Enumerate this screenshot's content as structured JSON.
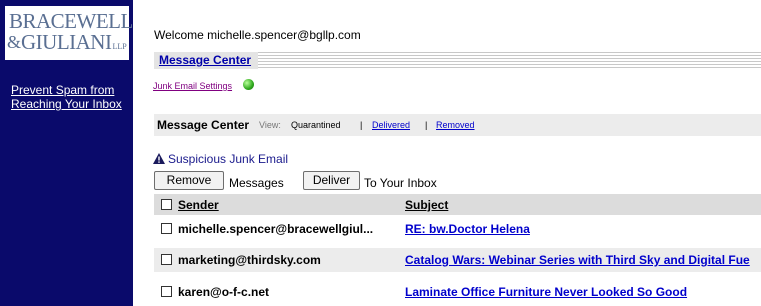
{
  "sidebar": {
    "logo_line1": "BRACEWELL",
    "logo_amp": "&",
    "logo_line2": "GIULIANI",
    "logo_llp": "LLP",
    "link": "Prevent Spam from Reaching Your Inbox"
  },
  "header": {
    "welcome": "Welcome michelle.spencer@bgllp.com",
    "tab": "Message Center",
    "junk_settings": "Junk Email Settings"
  },
  "view_bar": {
    "title": "Message Center",
    "view_label": "View:",
    "quarantined": "Quarantined",
    "separator": "|",
    "delivered": "Delivered",
    "removed": "Removed"
  },
  "section": {
    "title": "Suspicious Junk Email",
    "remove_button": "Remove",
    "messages_text": "Messages",
    "deliver_button": "Deliver",
    "inbox_text": "To Your Inbox"
  },
  "table": {
    "headers": {
      "sender": "Sender",
      "subject": "Subject"
    },
    "rows": [
      {
        "sender": "michelle.spencer@bracewellgiul...",
        "subject": "RE: bw.Doctor Helena"
      },
      {
        "sender": "marketing@thirdsky.com",
        "subject": "Catalog Wars: Webinar Series with Third Sky and Digital Fue"
      },
      {
        "sender": "karen@o-f-c.net",
        "subject": "Laminate Office Furniture Never Looked So Good"
      }
    ]
  },
  "colors": {
    "sidebar": "#0a0a6b",
    "link": "#0000cc",
    "status_dot": "#2ea81c"
  }
}
